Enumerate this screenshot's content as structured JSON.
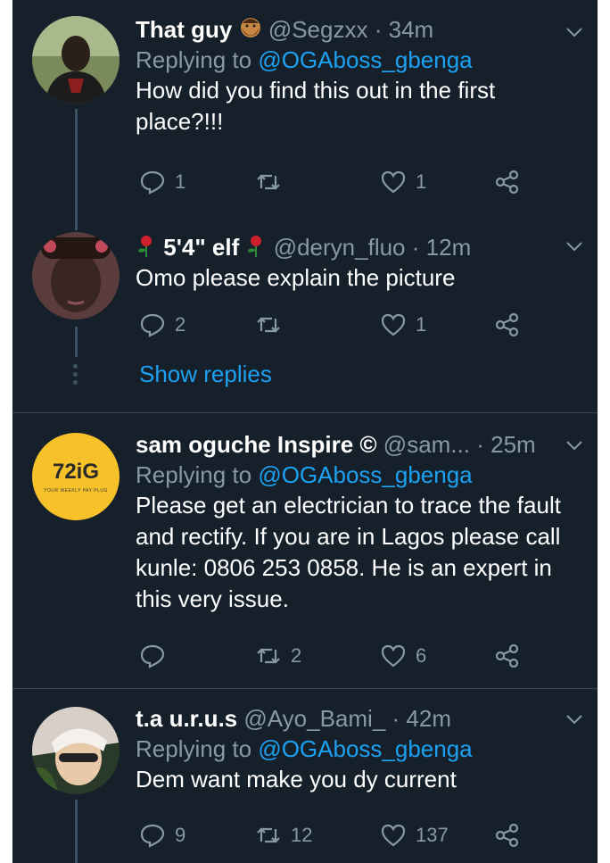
{
  "tweets": [
    {
      "name": "That guy",
      "handle": "@Segzxx",
      "time": "34m",
      "replying_label": "Replying to",
      "replying_to": "@OGAboss_gbenga",
      "text": "How did you find this out in the first place?!!!",
      "reply_count": "1",
      "retweet_count": "",
      "like_count": "1"
    },
    {
      "name": "5'4\" elf",
      "handle": "@deryn_fluo",
      "time": "12m",
      "text": "Omo please explain the picture",
      "reply_count": "2",
      "retweet_count": "",
      "like_count": "1",
      "show_replies": "Show replies"
    },
    {
      "name": "sam oguche Inspire ©",
      "handle": "@sam...",
      "time": "25m",
      "replying_label": "Replying to",
      "replying_to": "@OGAboss_gbenga",
      "text": "Please get an electrician to trace the fault and rectify. If you are in Lagos please call kunle: 0806 253 0858. He is an expert in this very issue.",
      "reply_count": "",
      "retweet_count": "2",
      "like_count": "6",
      "avatar_logo": "72iG",
      "avatar_tagline": "YOUR WEEKLY PAY PLUG"
    },
    {
      "name": "t.a u.r.u.s",
      "handle": "@Ayo_Bami_",
      "time": "42m",
      "replying_label": "Replying to",
      "replying_to": "@OGAboss_gbenga",
      "text": "Dem want make you dy current",
      "reply_count": "9",
      "retweet_count": "12",
      "like_count": "137"
    }
  ],
  "icons": {
    "reply": "reply-icon",
    "retweet": "retweet-icon",
    "like": "heart-icon",
    "share": "share-icon",
    "more": "chevron-down-icon"
  },
  "colors": {
    "background": "#15202b",
    "link": "#1da1f2",
    "muted": "#8899a6",
    "divider": "#38444d"
  }
}
